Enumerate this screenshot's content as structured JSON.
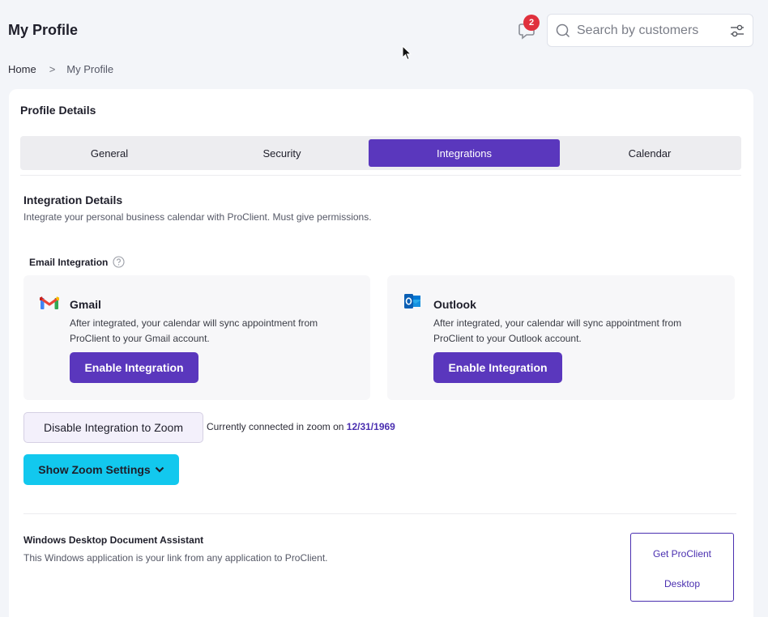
{
  "header": {
    "title": "My Profile",
    "notification_count": "2",
    "search_placeholder": "Search by customers"
  },
  "breadcrumb": {
    "home": "Home",
    "separator": ">",
    "current": "My Profile"
  },
  "profile": {
    "title": "Profile Details",
    "tabs": [
      {
        "label": "General",
        "active": false
      },
      {
        "label": "Security",
        "active": false
      },
      {
        "label": "Integrations",
        "active": true
      },
      {
        "label": "Calendar",
        "active": false
      }
    ]
  },
  "integration": {
    "title": "Integration Details",
    "subtitle": "Integrate your personal business calendar with ProClient. Must give permissions.",
    "email_label": "Email Integration",
    "providers": [
      {
        "name": "Gmail",
        "icon": "gmail-icon",
        "description": "After integrated, your calendar will sync appointment from ProClient to your Gmail account.",
        "button": "Enable Integration"
      },
      {
        "name": "Outlook",
        "icon": "outlook-icon",
        "description": "After integrated, your calendar will sync appointment from ProClient to your Outlook account.",
        "button": "Enable Integration"
      }
    ],
    "zoom": {
      "disable_button": "Disable Integration to Zoom",
      "status_text": "Currently connected in zoom on",
      "status_date": "12/31/1969",
      "settings_button": "Show Zoom Settings"
    }
  },
  "desktop": {
    "title": "Windows Desktop Document Assistant",
    "subtitle": "This Windows application is your link from any application to ProClient.",
    "button_line1": "Get ProClient",
    "button_line2": "Desktop"
  },
  "colors": {
    "primary": "#5a37bd",
    "cyan": "#12c8ee",
    "badge": "#e0303d",
    "background": "#f3f5f9"
  }
}
